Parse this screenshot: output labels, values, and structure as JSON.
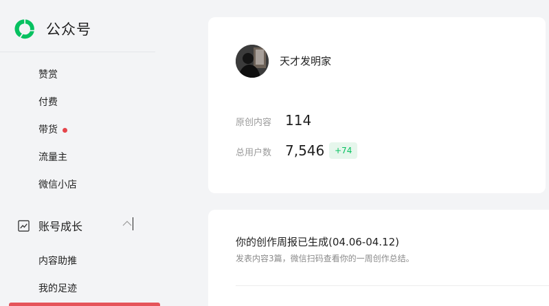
{
  "brand": {
    "name": "公众号"
  },
  "sidebar": {
    "items": [
      {
        "label": "赞赏"
      },
      {
        "label": "付费"
      },
      {
        "label": "带货",
        "has_dot": true
      },
      {
        "label": "流量主"
      },
      {
        "label": "微信小店"
      }
    ],
    "group": {
      "label": "账号成长",
      "icon": "trend-chart-icon",
      "expanded": true,
      "children": [
        {
          "label": "内容助推"
        },
        {
          "label": "我的足迹"
        }
      ]
    }
  },
  "profile": {
    "account_name": "天才发明家",
    "stats": {
      "original_label": "原创内容",
      "original_value": "114",
      "users_label": "总用户数",
      "users_value": "7,546",
      "users_change": "+74"
    }
  },
  "report": {
    "title": "你的创作周报已生成(04.06-04.12)",
    "description": "发表内容3篇，微信扫码查看你的一周创作总结。"
  },
  "colors": {
    "brand_green": "#07c160",
    "dot_red": "#e5454b",
    "badge_bg": "#e6f6ec"
  }
}
